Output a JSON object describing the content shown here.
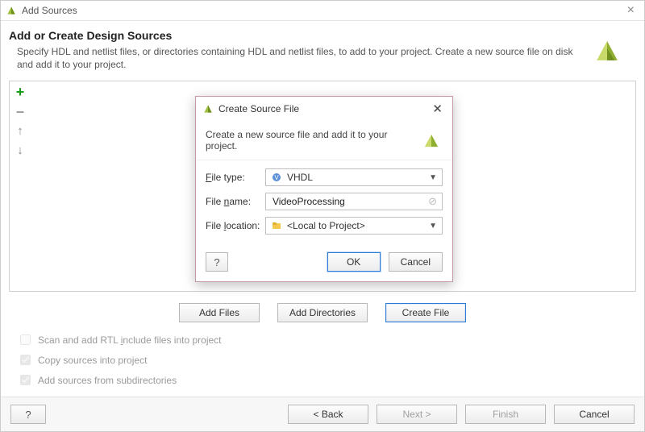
{
  "window": {
    "title": "Add Sources",
    "heading": "Add or Create Design Sources",
    "description": "Specify HDL and netlist files, or directories containing HDL and netlist files, to add to your project. Create a new source file on disk and add it to your project."
  },
  "side_buttons": {
    "add": "+",
    "remove": "–",
    "up": "↑",
    "down": "↓"
  },
  "actions": {
    "add_files": "Add Files",
    "add_dirs": "Add Directories",
    "create_file": "Create File"
  },
  "checkboxes": {
    "scan_label_pre": "Scan and add RTL ",
    "scan_u": "i",
    "scan_label_post": "nclude files into project",
    "copy": "Copy sources into project",
    "subdirs": "Add sources from subdirectories"
  },
  "footer": {
    "help": "?",
    "back": "< Back",
    "next": "Next >",
    "finish": "Finish",
    "cancel": "Cancel"
  },
  "modal": {
    "title": "Create Source File",
    "subtitle": "Create a new source file and add it to your project.",
    "file_type_u": "F",
    "file_type_rest": "ile type:",
    "file_type_value": "VHDL",
    "file_name_u": "n",
    "file_name_pre": "File ",
    "file_name_post": "ame:",
    "file_name_value": "VideoProcessing",
    "file_loc_u": "l",
    "file_loc_pre": "Fil",
    "file_loc_mid": "e ",
    "file_loc_post": "ocation:",
    "file_loc_value": "<Local to Project>",
    "help": "?",
    "ok": "OK",
    "cancel": "Cancel"
  }
}
